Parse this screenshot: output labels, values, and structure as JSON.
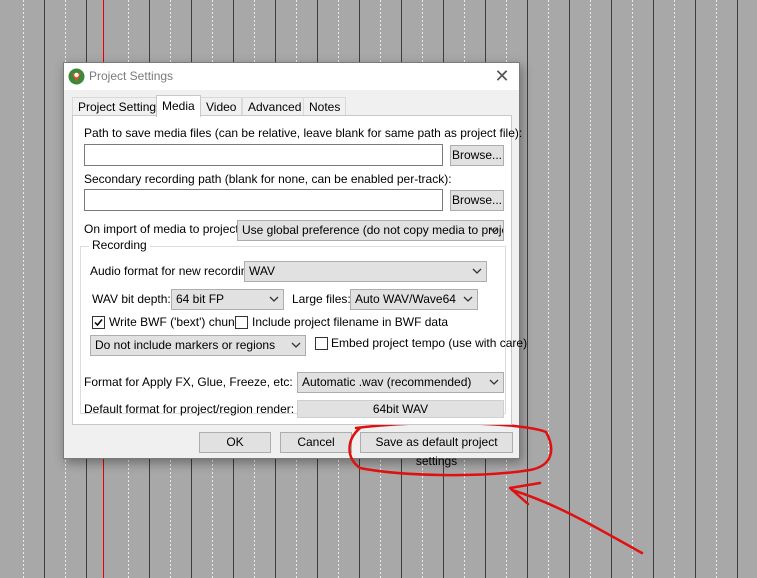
{
  "dialog": {
    "title": "Project Settings",
    "close_glyph": "✕",
    "tabs": [
      {
        "label": "Project Settings"
      },
      {
        "label": "Media"
      },
      {
        "label": "Video"
      },
      {
        "label": "Advanced"
      },
      {
        "label": "Notes"
      }
    ],
    "active_tab": "Media"
  },
  "media": {
    "path_label": "Path to save media files (can be relative, leave blank for same path as project file):",
    "path_value": "",
    "browse_label": "Browse...",
    "secondary_label": "Secondary recording path (blank for none, can be enabled per-track):",
    "secondary_value": "",
    "import_label": "On import of media to project:",
    "import_value": "Use global preference (do not copy media to project)",
    "recording": {
      "group_label": "Recording",
      "audio_format_label": "Audio format for new recordings:",
      "audio_format_value": "WAV",
      "bit_depth_label": "WAV bit depth:",
      "bit_depth_value": "64 bit FP",
      "large_files_label": "Large files:",
      "large_files_value": "Auto WAV/Wave64",
      "bwf_label": "Write BWF ('bext') chunk",
      "bwf_checked": true,
      "include_filename_label": "Include project filename in BWF data",
      "include_filename_checked": false,
      "markers_value": "Do not include markers or regions",
      "embed_tempo_label": "Embed project tempo (use with care)",
      "embed_tempo_checked": false
    },
    "apply_fx_label": "Format for Apply FX, Glue, Freeze, etc:",
    "apply_fx_value": "Automatic .wav (recommended)",
    "render_label": "Default format for project/region render:",
    "render_value": "64bit WAV"
  },
  "buttons": {
    "ok": "OK",
    "cancel": "Cancel",
    "save_default": "Save as default project settings"
  },
  "colors": {
    "annotation": "#e01010",
    "cursor": "#e60000",
    "background": "#a8a8a8"
  }
}
